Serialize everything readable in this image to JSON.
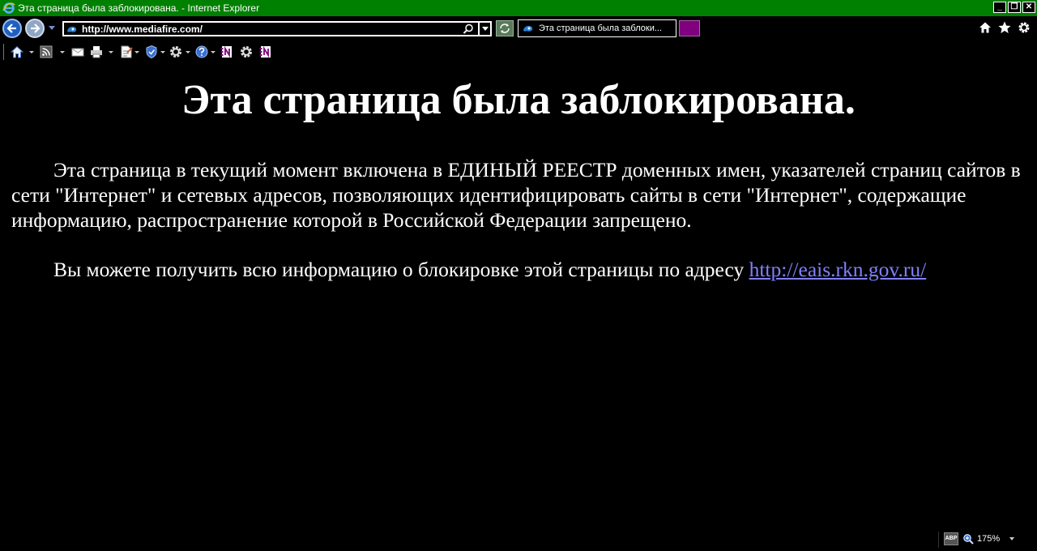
{
  "window": {
    "title": "Эта страница была заблокирована. - Internet Explorer",
    "minimize_label": "_",
    "maximize_label": "❐",
    "close_label": "✕"
  },
  "navigation": {
    "address_url": "http://www.mediafire.com/",
    "tab_label": "Эта страница была заблоки..."
  },
  "page": {
    "heading": "Эта страница была заблокирована.",
    "paragraph1": "Эта страница в текущий момент включена в ЕДИНЫЙ РЕЕСТР доменных имен, указателей страниц сайтов в сети \"Интернет\" и сетевых адресов, позволяющих идентифицировать сайты в сети \"Интернет\", содержащие информацию, распространение которой в Российской Федерации запрещено.",
    "paragraph2_prefix": "Вы можете получить всю информацию о блокировке этой страницы по адресу ",
    "paragraph2_link": "http://eais.rkn.gov.ru/"
  },
  "statusbar": {
    "abp_label": "ABP",
    "zoom_level": "175%"
  },
  "colors": {
    "titlebar_bg": "#008000",
    "page_bg": "#000000",
    "text": "#ffffff",
    "link": "#8080ff",
    "newtab_bg": "#800080"
  },
  "icons": {
    "back": "back-arrow-icon",
    "forward": "forward-arrow-icon",
    "search": "search-icon",
    "refresh": "refresh-icon",
    "home": "home-icon",
    "favorites": "star-icon",
    "tools": "gear-icon"
  }
}
